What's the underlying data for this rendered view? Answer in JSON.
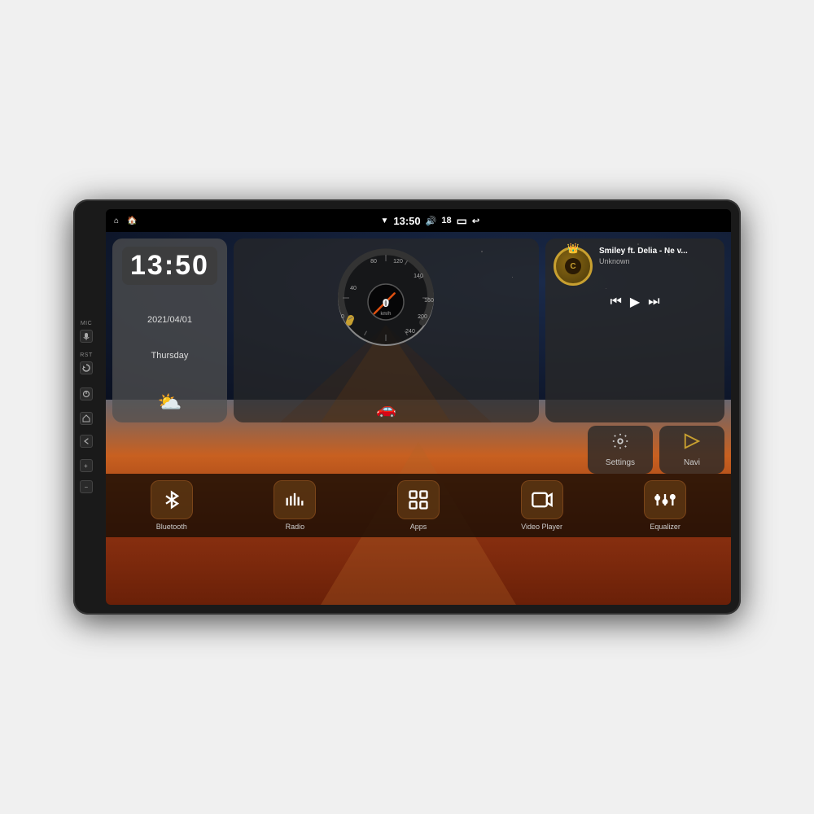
{
  "device": {
    "side_buttons": [
      {
        "id": "mic",
        "label": "MIC"
      },
      {
        "id": "rst",
        "label": "RST"
      },
      {
        "id": "power",
        "label": ""
      },
      {
        "id": "home",
        "label": ""
      },
      {
        "id": "back",
        "label": ""
      },
      {
        "id": "vol_up",
        "label": ""
      },
      {
        "id": "vol_down",
        "label": ""
      }
    ]
  },
  "status_bar": {
    "home_icon": "⌂",
    "android_icon": "🏠",
    "wifi_icon": "▼",
    "time": "13:50",
    "volume_icon": "🔊",
    "volume_level": "18",
    "battery_icon": "▭",
    "back_icon": "↩"
  },
  "clock_widget": {
    "time": "13:50",
    "date": "2021/04/01",
    "day": "Thursday",
    "weather_icon": "⛅"
  },
  "music_widget": {
    "title": "Smiley ft. Delia - Ne v...",
    "artist": "Unknown",
    "prev_icon": "⏮",
    "play_icon": "▶",
    "next_icon": "⏭"
  },
  "quick_apps": [
    {
      "id": "settings",
      "label": "Settings"
    },
    {
      "id": "navi",
      "label": "Navi"
    }
  ],
  "speedometer": {
    "speed": "0",
    "unit": "km/h",
    "max": "240"
  },
  "app_bar": [
    {
      "id": "bluetooth",
      "label": "Bluetooth"
    },
    {
      "id": "radio",
      "label": "Radio"
    },
    {
      "id": "apps",
      "label": "Apps"
    },
    {
      "id": "video_player",
      "label": "Video Player"
    },
    {
      "id": "equalizer",
      "label": "Equalizer"
    }
  ]
}
